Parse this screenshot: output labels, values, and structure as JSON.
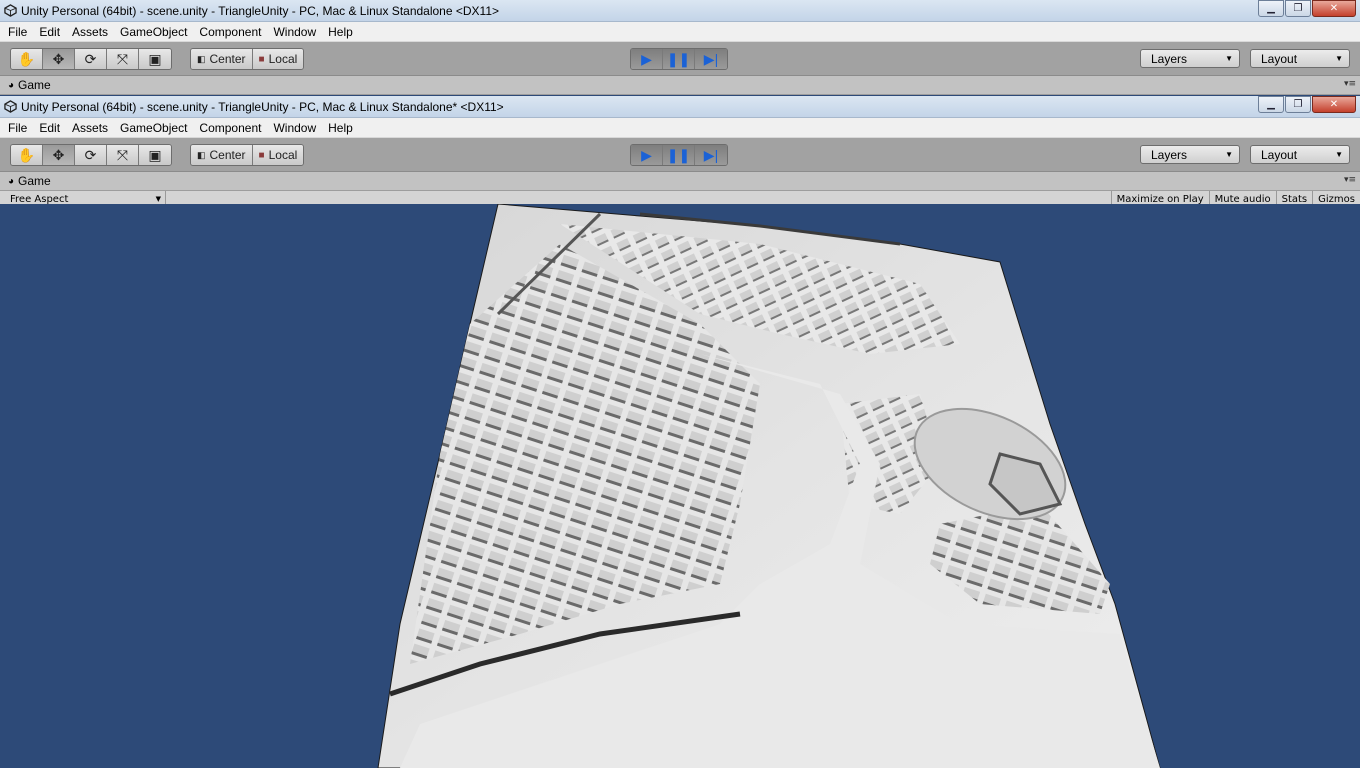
{
  "back_window": {
    "title": "Unity Personal (64bit) - scene.unity - TriangleUnity - PC, Mac & Linux Standalone <DX11>"
  },
  "front_window": {
    "title": "Unity Personal (64bit) - scene.unity - TriangleUnity - PC, Mac & Linux Standalone* <DX11>"
  },
  "menu": [
    "File",
    "Edit",
    "Assets",
    "GameObject",
    "Component",
    "Window",
    "Help"
  ],
  "toolbar": {
    "tools": [
      "hand-icon",
      "move-icon",
      "rotate-icon",
      "scale-icon",
      "rect-tool-icon"
    ],
    "pivot_center": "Center",
    "pivot_local": "Local",
    "play": [
      "play-icon",
      "pause-icon",
      "step-icon"
    ],
    "layers_label": "Layers",
    "layout_label": "Layout",
    "accent": "#1b62d6"
  },
  "game_tab": {
    "label": "Game",
    "aspect": "Free Aspect",
    "buttons": [
      "Maximize on Play",
      "Mute audio",
      "Stats",
      "Gizmos"
    ]
  },
  "viewport_bg": "#2d4a78"
}
